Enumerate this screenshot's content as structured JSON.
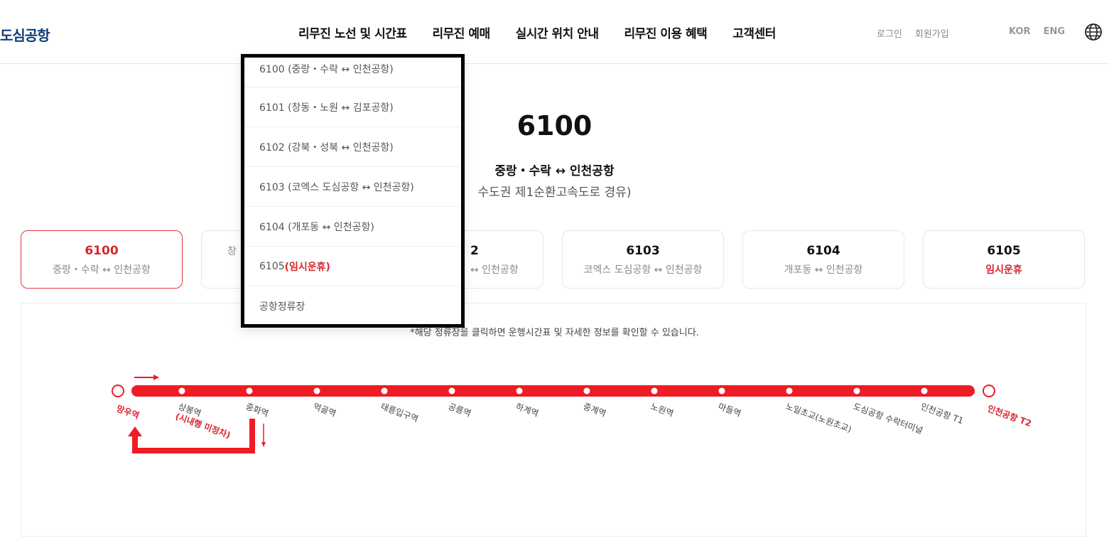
{
  "header": {
    "logo": "도심공항",
    "nav": [
      "리무진 노선 및 시간표",
      "리무진 예매",
      "실시간 위치 안내",
      "리무진 이용 혜택",
      "고객센터"
    ],
    "login": "로그인",
    "signup": "회원가입",
    "lang_kor": "KOR",
    "lang_eng": "ENG"
  },
  "route": {
    "number": "6100",
    "name": "중랑・수락 ↔ 인천공항",
    "via_visible": "수도권 제1순환고속도로 경유)"
  },
  "cards": [
    {
      "number": "6100",
      "desc": "중랑・수락 ↔ 인천공항",
      "active": true
    },
    {
      "number": "",
      "desc": "창"
    },
    {
      "number": "2",
      "desc": "↔ 인천공항"
    },
    {
      "number": "6103",
      "desc": "코엑스 도심공항 ↔ 인천공항"
    },
    {
      "number": "6104",
      "desc": "개포동 ↔ 인천공항"
    },
    {
      "number": "6105",
      "desc": "임시운휴",
      "suspended": true
    }
  ],
  "dropdown": [
    {
      "label": "6100 (중랑・수락 ↔ 인천공항)"
    },
    {
      "label": "6101 (창동・노원 ↔ 김포공항)"
    },
    {
      "label": "6102 (강북・성북 ↔ 인천공항)"
    },
    {
      "label": "6103 (코엑스 도심공항 ↔ 인천공항)"
    },
    {
      "label": "6104 (개포동 ↔ 인천공항)"
    },
    {
      "label": "6105",
      "suffix": "(임시운휴)"
    },
    {
      "label": "공항정류장"
    }
  ],
  "map": {
    "note": "*해당 정류장을 클릭하면 운행시간표 및 자세한 정보를 확인할 수 있습니다.",
    "start": "망우역",
    "end": "인천공항 T2",
    "stops": [
      "상봉역",
      "중화역",
      "먹골역",
      "태릉입구역",
      "공릉역",
      "하계역",
      "중계역",
      "노원역",
      "마들역",
      "노일초교(노원초교)",
      "도심공항 수락터미널",
      "인천공항 T1"
    ],
    "sangbong_note": "(시내행 미정차)",
    "line_color": "#ee1c25"
  }
}
